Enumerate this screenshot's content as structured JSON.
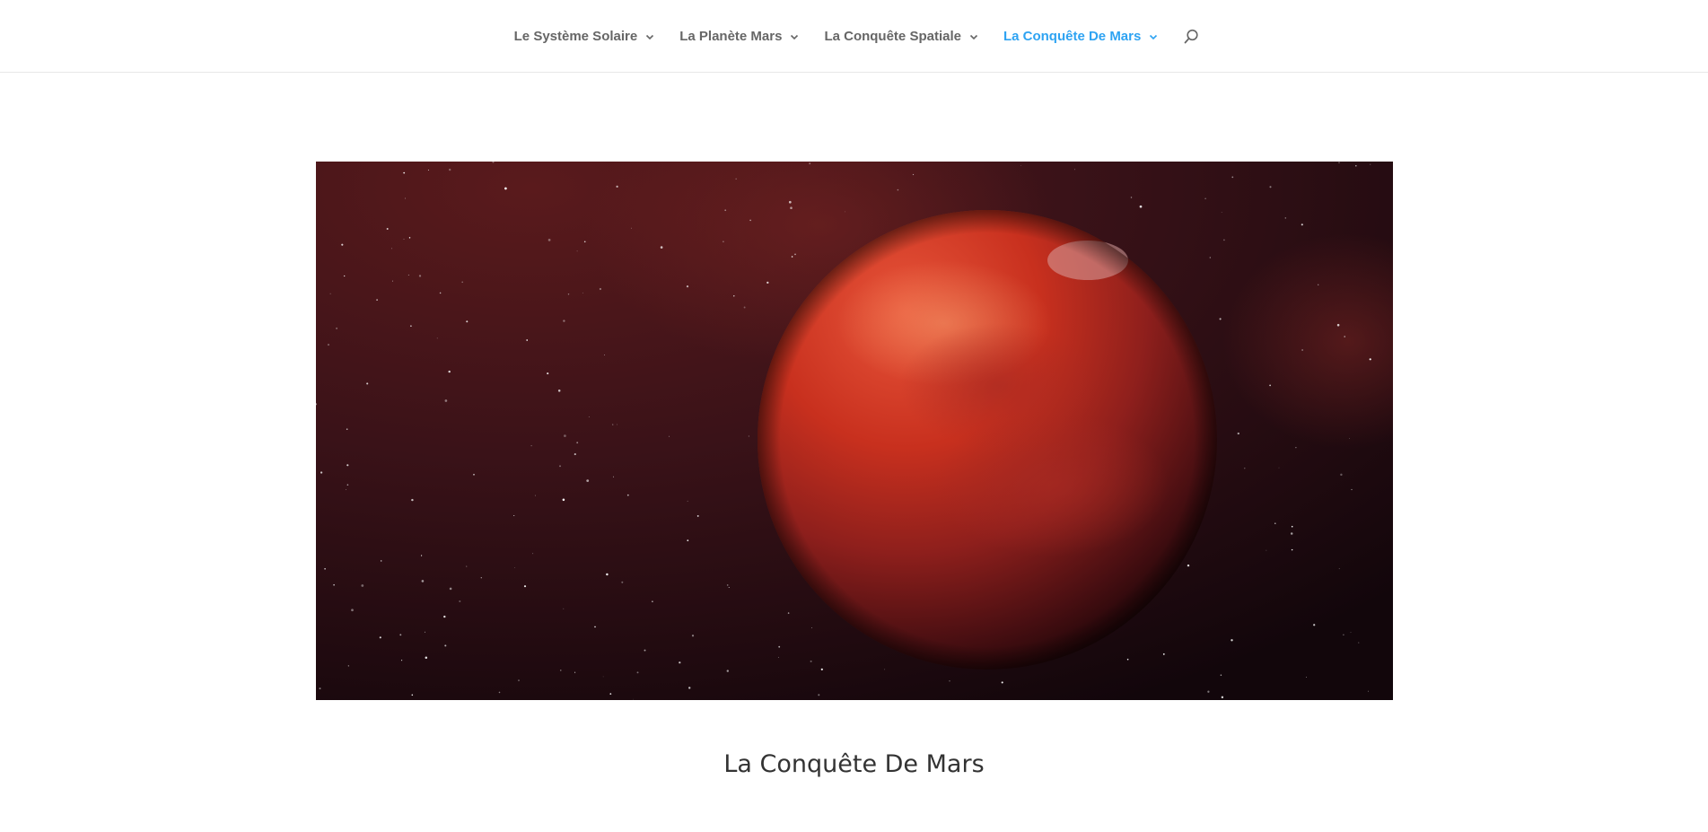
{
  "nav": {
    "items": [
      {
        "label": "Le Système Solaire",
        "active": false
      },
      {
        "label": "La Planète Mars",
        "active": false
      },
      {
        "label": "La Conquête Spatiale",
        "active": false
      },
      {
        "label": "La Conquête De Mars",
        "active": true
      }
    ],
    "search_icon": "search-icon",
    "accent_color": "#2ea3f2",
    "text_color": "#666666"
  },
  "hero": {
    "image": "mars-planet-in-space",
    "background_color": "#2a0c10"
  },
  "page": {
    "title": "La Conquête De Mars"
  }
}
